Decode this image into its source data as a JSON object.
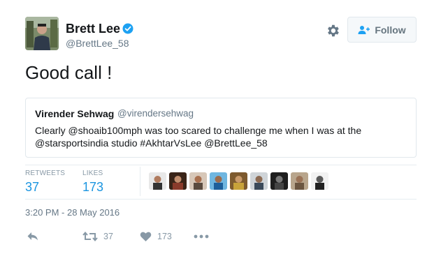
{
  "author": {
    "name": "Brett Lee",
    "handle": "@BrettLee_58",
    "verified_icon": "verified-badge-icon"
  },
  "header": {
    "settings_icon": "gear-icon",
    "follow_label": "Follow",
    "follow_icon": "add-user-icon"
  },
  "tweet": {
    "text": "Good call !"
  },
  "quoted_tweet": {
    "name": "Virender Sehwag",
    "handle": "@virendersehwag",
    "text": "Clearly @shoaib100mph was too scared to challenge me when I was at the @starsportsindia studio #AkhtarVsLee @BrettLee_58"
  },
  "stats": {
    "retweets_label": "RETWEETS",
    "retweets_count": "37",
    "likes_label": "LIKES",
    "likes_count": "173"
  },
  "likers_count_shown": 9,
  "timestamp": "3:20 PM - 28 May 2016",
  "actions": {
    "reply_icon": "reply-icon",
    "retweet_icon": "retweet-icon",
    "retweet_count": "37",
    "like_icon": "heart-icon",
    "like_count": "173",
    "more_icon": "more-dots-icon"
  },
  "colors": {
    "link_blue": "#1b95e0",
    "verified_blue": "#1da1f2",
    "muted": "#657786",
    "action_gray": "#8899a6",
    "border": "#e1e8ed"
  }
}
